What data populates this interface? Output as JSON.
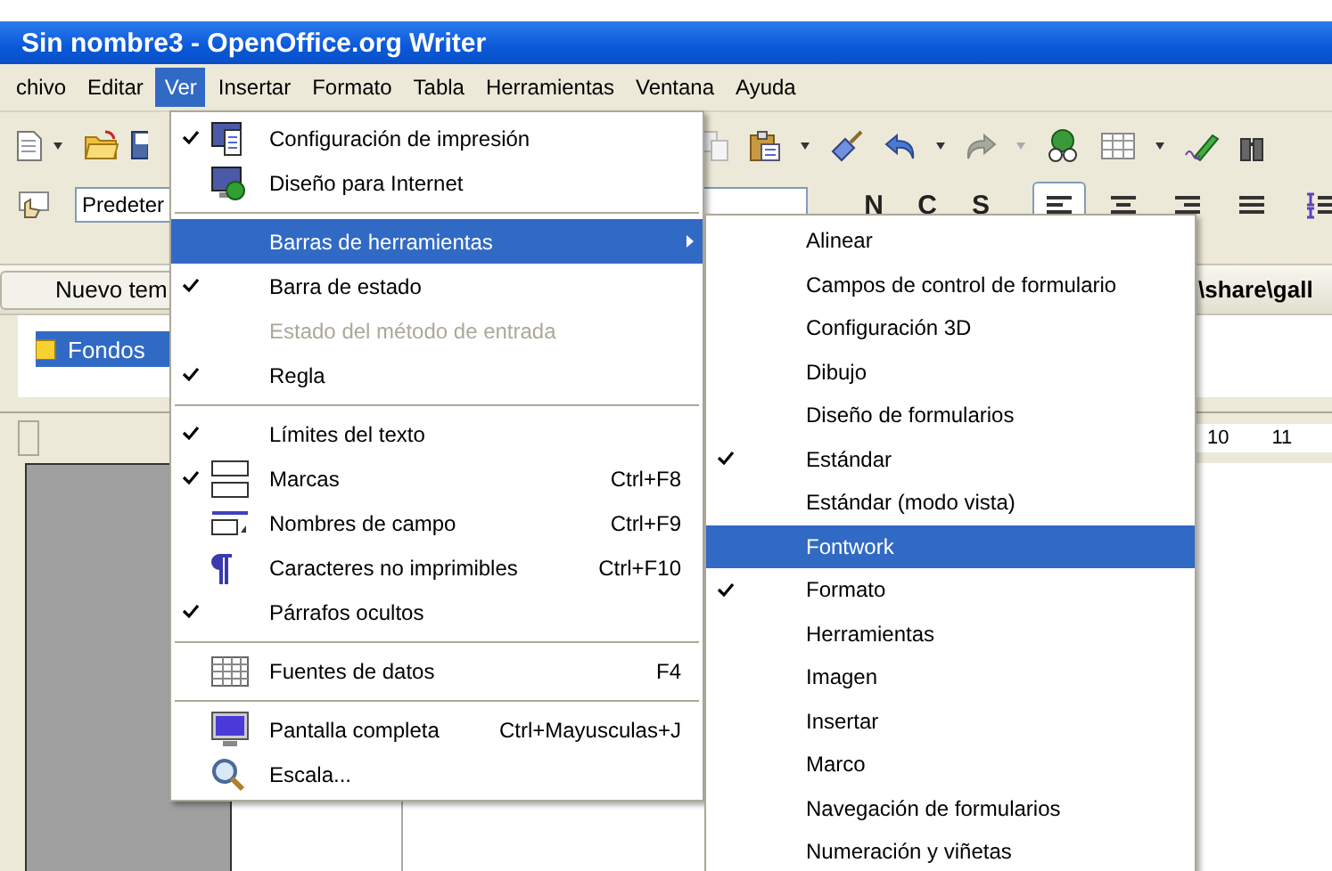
{
  "window": {
    "title": "Sin nombre3 - OpenOffice.org Writer"
  },
  "menubar": [
    {
      "label": "chivo",
      "selected": false
    },
    {
      "label": "Editar",
      "selected": false
    },
    {
      "label": "Ver",
      "selected": true
    },
    {
      "label": "Insertar",
      "selected": false
    },
    {
      "label": "Formato",
      "selected": false
    },
    {
      "label": "Tabla",
      "selected": false
    },
    {
      "label": "Herramientas",
      "selected": false
    },
    {
      "label": "Ventana",
      "selected": false
    },
    {
      "label": "Ayuda",
      "selected": false
    }
  ],
  "formatting": {
    "paragraph_style": "Predeter",
    "character_buttons": [
      "N",
      "C",
      "S"
    ],
    "alignment": [
      {
        "selected": true
      },
      {
        "selected": false
      },
      {
        "selected": false
      },
      {
        "selected": false
      }
    ]
  },
  "gallery": {
    "new_theme_button": "Nuevo tem",
    "path": "\\share\\gall",
    "themes": [
      {
        "label": "Fondos",
        "selected": true
      }
    ]
  },
  "ruler": {
    "marks": [
      "10",
      "11"
    ]
  },
  "view_menu": {
    "items": [
      {
        "kind": "item",
        "label": "Configuración de impresión",
        "checked": true,
        "disabled": false,
        "selected": false,
        "submenu": false
      },
      {
        "kind": "item",
        "label": "Diseño para Internet",
        "checked": false,
        "disabled": false,
        "selected": false,
        "submenu": false
      },
      {
        "kind": "separator"
      },
      {
        "kind": "item",
        "label": "Barras de herramientas",
        "checked": false,
        "disabled": false,
        "selected": true,
        "submenu": true
      },
      {
        "kind": "item",
        "label": "Barra de estado",
        "checked": true,
        "disabled": false,
        "selected": false,
        "submenu": false
      },
      {
        "kind": "item",
        "label": "Estado del método de entrada",
        "checked": false,
        "disabled": true,
        "selected": false,
        "submenu": false
      },
      {
        "kind": "item",
        "label": "Regla",
        "checked": true,
        "disabled": false,
        "selected": false,
        "submenu": false
      },
      {
        "kind": "separator"
      },
      {
        "kind": "item",
        "label": "Límites del texto",
        "checked": true,
        "disabled": false,
        "selected": false,
        "submenu": false
      },
      {
        "kind": "item",
        "label": "Marcas",
        "shortcut": "Ctrl+F8",
        "checked": true,
        "disabled": false,
        "selected": false,
        "submenu": false
      },
      {
        "kind": "item",
        "label": "Nombres de campo",
        "shortcut": "Ctrl+F9",
        "checked": false,
        "disabled": false,
        "selected": false,
        "submenu": false
      },
      {
        "kind": "item",
        "label": "Caracteres no imprimibles",
        "shortcut": "Ctrl+F10",
        "checked": false,
        "disabled": false,
        "selected": false,
        "submenu": false
      },
      {
        "kind": "item",
        "label": "Párrafos ocultos",
        "checked": true,
        "disabled": false,
        "selected": false,
        "submenu": false
      },
      {
        "kind": "separator"
      },
      {
        "kind": "item",
        "label": "Fuentes de datos",
        "shortcut": "F4",
        "checked": false,
        "disabled": false,
        "selected": false,
        "submenu": false
      },
      {
        "kind": "separator"
      },
      {
        "kind": "item",
        "label": "Pantalla completa",
        "shortcut": "Ctrl+Mayusculas+J",
        "checked": false,
        "disabled": false,
        "selected": false,
        "submenu": false
      },
      {
        "kind": "item",
        "label": "Escala...",
        "checked": false,
        "disabled": false,
        "selected": false,
        "submenu": false
      }
    ]
  },
  "toolbars_submenu": {
    "items": [
      {
        "label": "Alinear",
        "checked": false,
        "selected": false
      },
      {
        "label": "Campos de control de formulario",
        "checked": false,
        "selected": false
      },
      {
        "label": "Configuración 3D",
        "checked": false,
        "selected": false
      },
      {
        "label": "Dibujo",
        "checked": false,
        "selected": false
      },
      {
        "label": "Diseño de formularios",
        "checked": false,
        "selected": false
      },
      {
        "label": "Estándar",
        "checked": true,
        "selected": false
      },
      {
        "label": "Estándar (modo vista)",
        "checked": false,
        "selected": false
      },
      {
        "label": "Fontwork",
        "checked": false,
        "selected": true
      },
      {
        "label": "Formato",
        "checked": true,
        "selected": false
      },
      {
        "label": "Herramientas",
        "checked": false,
        "selected": false
      },
      {
        "label": "Imagen",
        "checked": false,
        "selected": false
      },
      {
        "label": "Insertar",
        "checked": false,
        "selected": false
      },
      {
        "label": "Marco",
        "checked": false,
        "selected": false
      },
      {
        "label": "Navegación de formularios",
        "checked": false,
        "selected": false
      },
      {
        "label": "Numeración y viñetas",
        "checked": false,
        "selected": false
      }
    ]
  }
}
